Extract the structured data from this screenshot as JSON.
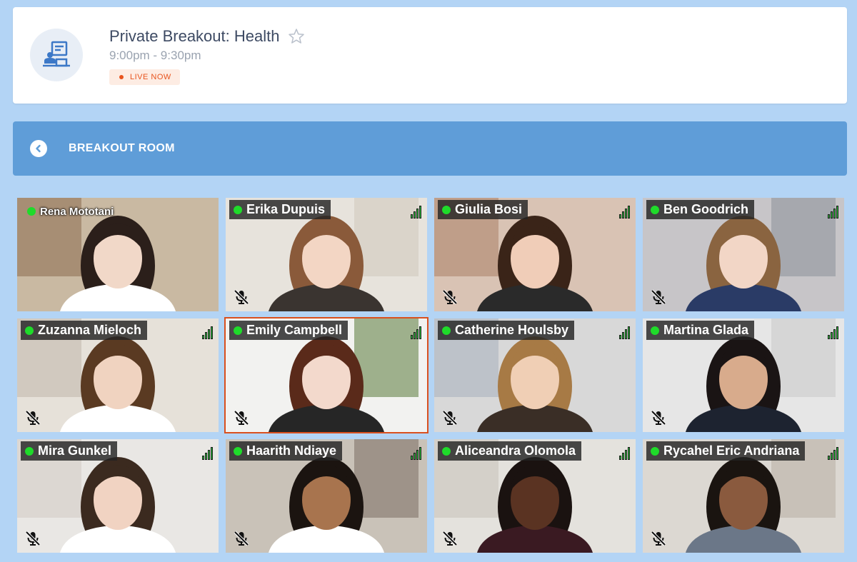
{
  "event": {
    "title": "Private Breakout: Health",
    "time": "9:00pm - 9:30pm",
    "status": "LIVE NOW",
    "accent_color": "#e8541e"
  },
  "breakout": {
    "label": "BREAKOUT ROOM",
    "bar_color": "#5f9dd8"
  },
  "participants": [
    {
      "name": "Rena Mototani",
      "online": true,
      "muted": false,
      "signal": false
    },
    {
      "name": "Erika Dupuis",
      "online": true,
      "muted": true,
      "signal": true
    },
    {
      "name": "Giulia Bosi",
      "online": true,
      "muted": true,
      "signal": true
    },
    {
      "name": "Ben Goodrich",
      "online": true,
      "muted": true,
      "signal": true
    },
    {
      "name": "Zuzanna Mieloch",
      "online": true,
      "muted": true,
      "signal": true
    },
    {
      "name": "Emily Campbell",
      "online": true,
      "muted": true,
      "signal": true,
      "active": true
    },
    {
      "name": "Catherine Houlsby",
      "online": true,
      "muted": true,
      "signal": true
    },
    {
      "name": "Martina Glada",
      "online": true,
      "muted": true,
      "signal": true
    },
    {
      "name": "Mira Gunkel",
      "online": true,
      "muted": true,
      "signal": true
    },
    {
      "name": "Haarith Ndiaye",
      "online": true,
      "muted": true,
      "signal": true
    },
    {
      "name": "Aliceandra Olomola",
      "online": true,
      "muted": true,
      "signal": true
    },
    {
      "name": "Rycahel Eric Andriana",
      "online": true,
      "muted": true,
      "signal": true
    }
  ]
}
